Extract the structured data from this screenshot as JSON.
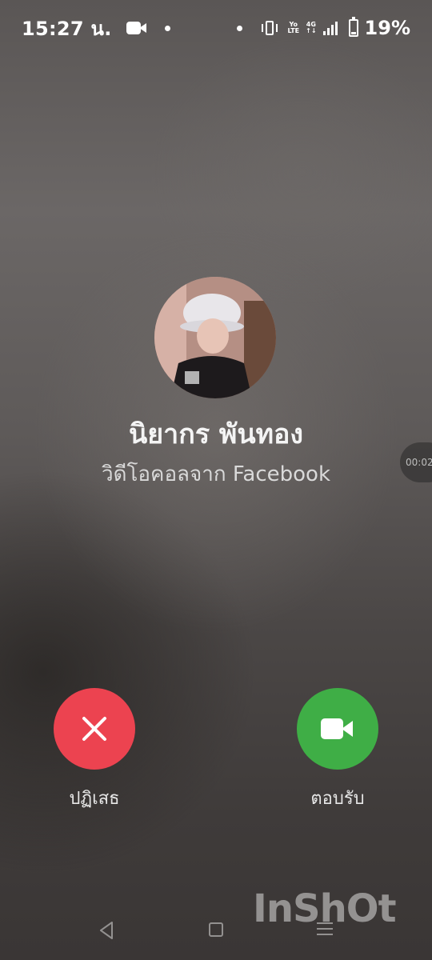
{
  "status_bar": {
    "time": "15:27 น.",
    "network_top": "Yo",
    "network_bottom": "LTE",
    "network2_top": "4G",
    "network2_bottom": "↑↓",
    "battery_percent": "19%",
    "battery_level": 0.19,
    "icons": [
      "video-camera-icon",
      "notification-dot-icon",
      "vibrate-icon",
      "signal-icon",
      "battery-icon"
    ]
  },
  "caller": {
    "name": "นิยากร พันทอง",
    "subtitle": "วิดีโอคอลจาก Facebook",
    "timer": "00:02"
  },
  "actions": {
    "decline_label": "ปฏิเสธ",
    "accept_label": "ตอบรับ",
    "decline_color": "#ec4350",
    "accept_color": "#3fae46"
  },
  "watermark": "InShOt",
  "nav": {
    "icons": [
      "back-icon",
      "home-icon",
      "recents-icon"
    ]
  }
}
